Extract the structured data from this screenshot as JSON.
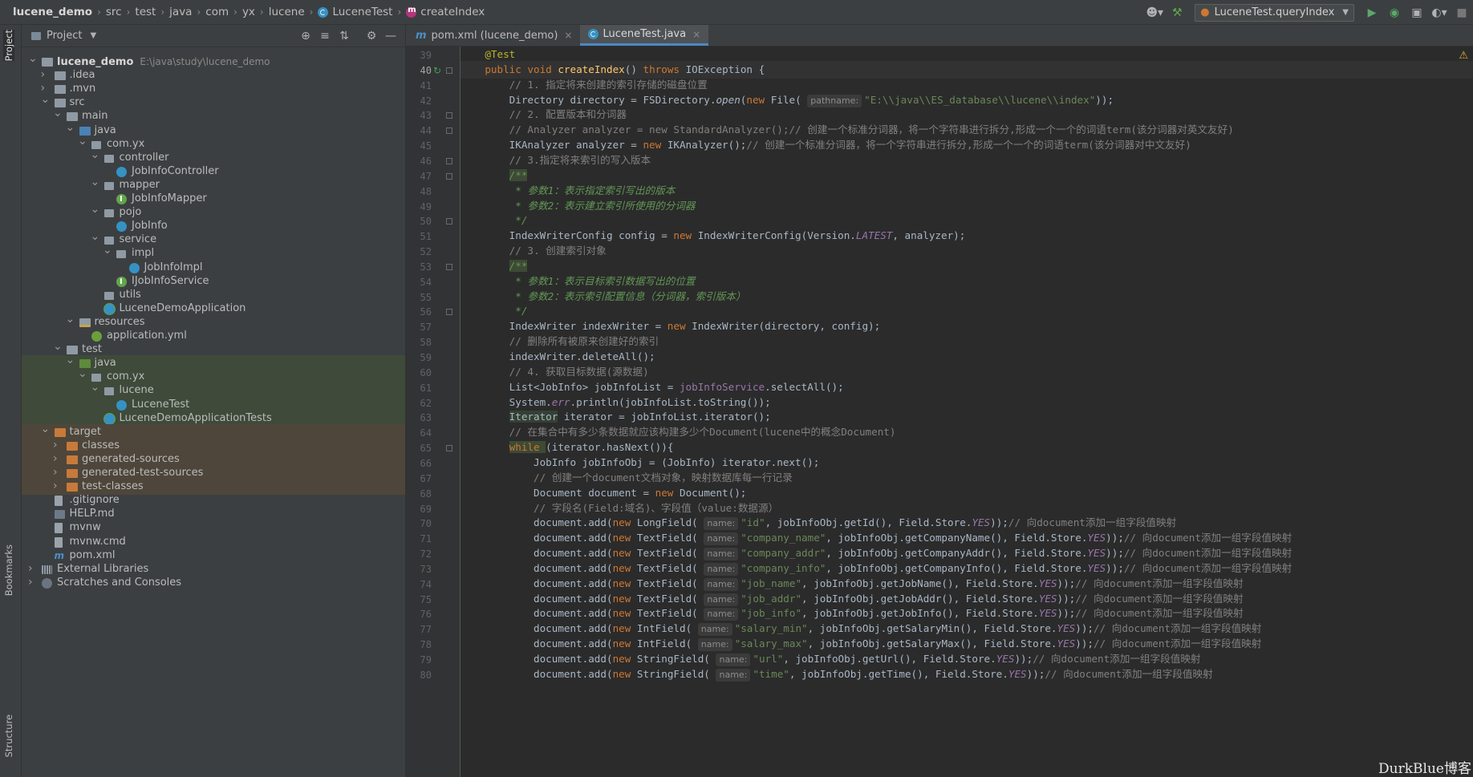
{
  "breadcrumbs": [
    "lucene_demo",
    "src",
    "test",
    "java",
    "com",
    "yx",
    "lucene",
    "LuceneTest",
    "createIndex"
  ],
  "toolbar": {
    "run_config": "LuceneTest.queryIndex"
  },
  "left_stripe": {
    "project_tab": "Project",
    "bookmarks_tab": "Bookmarks",
    "structure_tab": "Structure"
  },
  "project_panel": {
    "title": "Project",
    "tree": [
      {
        "label": "lucene_demo",
        "path": "E:\\java\\study\\lucene_demo",
        "depth": 0,
        "arrow": "open",
        "icon": "folder-icon",
        "style": "bold"
      },
      {
        "label": ".idea",
        "depth": 1,
        "arrow": "closed",
        "icon": "folder-icon"
      },
      {
        "label": ".mvn",
        "depth": 1,
        "arrow": "closed",
        "icon": "folder-icon"
      },
      {
        "label": "src",
        "depth": 1,
        "arrow": "open",
        "icon": "folder-icon"
      },
      {
        "label": "main",
        "depth": 2,
        "arrow": "open",
        "icon": "folder-icon"
      },
      {
        "label": "java",
        "depth": 3,
        "arrow": "open",
        "icon": "source-folder-icon"
      },
      {
        "label": "com.yx",
        "depth": 4,
        "arrow": "open",
        "icon": "package-icon"
      },
      {
        "label": "controller",
        "depth": 5,
        "arrow": "open",
        "icon": "package-icon"
      },
      {
        "label": "JobInfoController",
        "depth": 6,
        "arrow": "",
        "icon": "class-icon"
      },
      {
        "label": "mapper",
        "depth": 5,
        "arrow": "open",
        "icon": "package-icon"
      },
      {
        "label": "JobInfoMapper",
        "depth": 6,
        "arrow": "",
        "icon": "interface-icon"
      },
      {
        "label": "pojo",
        "depth": 5,
        "arrow": "open",
        "icon": "package-icon"
      },
      {
        "label": "JobInfo",
        "depth": 6,
        "arrow": "",
        "icon": "class-icon"
      },
      {
        "label": "service",
        "depth": 5,
        "arrow": "open",
        "icon": "package-icon"
      },
      {
        "label": "impl",
        "depth": 6,
        "arrow": "open",
        "icon": "package-icon"
      },
      {
        "label": "JobInfoImpl",
        "depth": 7,
        "arrow": "",
        "icon": "class-icon"
      },
      {
        "label": "IJobInfoService",
        "depth": 6,
        "arrow": "",
        "icon": "interface-icon"
      },
      {
        "label": "utils",
        "depth": 5,
        "arrow": "",
        "icon": "package-icon"
      },
      {
        "label": "LuceneDemoApplication",
        "depth": 5,
        "arrow": "",
        "icon": "spring-class-icon"
      },
      {
        "label": "resources",
        "depth": 3,
        "arrow": "open",
        "icon": "resources-folder-icon"
      },
      {
        "label": "application.yml",
        "depth": 4,
        "arrow": "",
        "icon": "yml-file-icon"
      },
      {
        "label": "test",
        "depth": 2,
        "arrow": "open",
        "icon": "folder-icon"
      },
      {
        "label": "java",
        "depth": 3,
        "arrow": "open",
        "icon": "test-folder-icon",
        "bg": "green"
      },
      {
        "label": "com.yx",
        "depth": 4,
        "arrow": "open",
        "icon": "package-icon",
        "bg": "green"
      },
      {
        "label": "lucene",
        "depth": 5,
        "arrow": "open",
        "icon": "package-icon",
        "bg": "green"
      },
      {
        "label": "LuceneTest",
        "depth": 6,
        "arrow": "",
        "icon": "class-icon",
        "bg": "green"
      },
      {
        "label": "LuceneDemoApplicationTests",
        "depth": 5,
        "arrow": "",
        "icon": "spring-class-icon",
        "bg": "green"
      },
      {
        "label": "target",
        "depth": 1,
        "arrow": "open",
        "icon": "target-folder-icon",
        "bg": "brown"
      },
      {
        "label": "classes",
        "depth": 2,
        "arrow": "closed",
        "icon": "target-folder-icon",
        "bg": "brown"
      },
      {
        "label": "generated-sources",
        "depth": 2,
        "arrow": "closed",
        "icon": "target-folder-icon",
        "bg": "brown"
      },
      {
        "label": "generated-test-sources",
        "depth": 2,
        "arrow": "closed",
        "icon": "target-folder-icon",
        "bg": "brown"
      },
      {
        "label": "test-classes",
        "depth": 2,
        "arrow": "closed",
        "icon": "target-folder-icon",
        "bg": "brown"
      },
      {
        "label": ".gitignore",
        "depth": 1,
        "arrow": "",
        "icon": "file-icon"
      },
      {
        "label": "HELP.md",
        "depth": 1,
        "arrow": "",
        "icon": "markdown-file-icon"
      },
      {
        "label": "mvnw",
        "depth": 1,
        "arrow": "",
        "icon": "file-icon"
      },
      {
        "label": "mvnw.cmd",
        "depth": 1,
        "arrow": "",
        "icon": "file-icon"
      },
      {
        "label": "pom.xml",
        "depth": 1,
        "arrow": "",
        "icon": "maven-file-icon"
      },
      {
        "label": "External Libraries",
        "depth": 0,
        "arrow": "closed",
        "icon": "library-icon"
      },
      {
        "label": "Scratches and Consoles",
        "depth": 0,
        "arrow": "closed",
        "icon": "scratch-icon"
      }
    ]
  },
  "editor": {
    "tabs": [
      {
        "label": "pom.xml (lucene_demo)",
        "icon": "maven-file-icon",
        "active": false
      },
      {
        "label": "LuceneTest.java",
        "icon": "class-icon",
        "active": true
      }
    ],
    "first_line": 39,
    "current_line": 40,
    "lines": [
      [
        [
          "    ",
          ""
        ],
        [
          "@Test",
          "ann"
        ]
      ],
      [
        [
          "    ",
          ""
        ],
        [
          "public void ",
          "kw"
        ],
        [
          "createIndex",
          "fn"
        ],
        [
          "() ",
          ""
        ],
        [
          "throws ",
          "kw"
        ],
        [
          "IOException {",
          ""
        ]
      ],
      [
        [
          "        ",
          ""
        ],
        [
          "// 1. 指定将来创建的索引存储的磁盘位置",
          "cmt"
        ]
      ],
      [
        [
          "        Directory directory = FSDirectory.",
          ""
        ],
        [
          "open",
          "mthi"
        ],
        [
          "(",
          ""
        ],
        [
          "new ",
          "kw"
        ],
        [
          "File( ",
          ""
        ],
        [
          "pathname:",
          "hint"
        ],
        [
          "\"E:\\\\java\\\\ES_database\\\\lucene\\\\index\"",
          "str"
        ],
        [
          "));",
          ""
        ]
      ],
      [
        [
          "        ",
          ""
        ],
        [
          "// 2. 配置版本和分词器",
          "cmt"
        ]
      ],
      [
        [
          "        ",
          ""
        ],
        [
          "// Analyzer analyzer = new StandardAnalyzer();// 创建一个标准分词器，将一个字符串进行拆分,形成一个一个的词语term(该分词器对英文友好)",
          "cmt"
        ]
      ],
      [
        [
          "        IKAnalyzer analyzer = ",
          ""
        ],
        [
          "new ",
          "kw"
        ],
        [
          "IKAnalyzer();",
          ""
        ],
        [
          "// 创建一个标准分词器，将一个字符串进行拆分,形成一个一个的词语term(该分词器对中文友好)",
          "cmt"
        ]
      ],
      [
        [
          "        ",
          ""
        ],
        [
          "// 3.指定将来索引的写入版本",
          "cmt"
        ]
      ],
      [
        [
          "        ",
          ""
        ],
        [
          "/**",
          "doc docbg"
        ]
      ],
      [
        [
          "        ",
          ""
        ],
        [
          " * 参数1：表示指定索引写出的版本",
          "doc"
        ]
      ],
      [
        [
          "        ",
          ""
        ],
        [
          " * 参数2：表示建立索引所使用的分词器",
          "doc"
        ]
      ],
      [
        [
          "        ",
          ""
        ],
        [
          " */",
          "doc"
        ]
      ],
      [
        [
          "        IndexWriterConfig config = ",
          ""
        ],
        [
          "new ",
          "kw"
        ],
        [
          "IndexWriterConfig(Version.",
          ""
        ],
        [
          "LATEST",
          "fldi"
        ],
        [
          ", analyzer);",
          ""
        ]
      ],
      [
        [
          "        ",
          ""
        ],
        [
          "// 3. 创建索引对象",
          "cmt"
        ]
      ],
      [
        [
          "        ",
          ""
        ],
        [
          "/**",
          "doc docbg"
        ]
      ],
      [
        [
          "        ",
          ""
        ],
        [
          " * 参数1：表示目标索引数据写出的位置",
          "doc"
        ]
      ],
      [
        [
          "        ",
          ""
        ],
        [
          " * 参数2：表示索引配置信息（分词器，索引版本）",
          "doc"
        ]
      ],
      [
        [
          "        ",
          ""
        ],
        [
          " */",
          "doc"
        ]
      ],
      [
        [
          "        IndexWriter indexWriter = ",
          ""
        ],
        [
          "new ",
          "kw"
        ],
        [
          "IndexWriter(directory, config);",
          ""
        ]
      ],
      [
        [
          "        ",
          ""
        ],
        [
          "// 删除所有被原来创建好的索引",
          "cmt"
        ]
      ],
      [
        [
          "        indexWriter.deleteAll();",
          ""
        ]
      ],
      [
        [
          "        ",
          ""
        ],
        [
          "// 4. 获取目标数据(源数据)",
          "cmt"
        ]
      ],
      [
        [
          "        List<JobInfo> jobInfoList = ",
          ""
        ],
        [
          "jobInfoService",
          "fld"
        ],
        [
          ".selectAll();",
          ""
        ]
      ],
      [
        [
          "        System.",
          ""
        ],
        [
          "err",
          "fldi"
        ],
        [
          ".println(jobInfoList.toString());",
          ""
        ]
      ],
      [
        [
          "        ",
          ""
        ],
        [
          "Iterator",
          "iter-bg"
        ],
        [
          " iterator = jobInfoList.iterator();",
          ""
        ]
      ],
      [
        [
          "        ",
          ""
        ],
        [
          "// 在集合中有多少条数据就应该构建多少个Document(lucene中的概念Document)",
          "cmt"
        ]
      ],
      [
        [
          "        ",
          ""
        ],
        [
          "while ",
          "kw docbg"
        ],
        [
          "(iterator.hasNext()){",
          ""
        ]
      ],
      [
        [
          "            JobInfo jobInfoObj = (JobInfo) iterator.next();",
          ""
        ]
      ],
      [
        [
          "            ",
          ""
        ],
        [
          "// 创建一个document文档对象，映射数据库每一行记录",
          "cmt"
        ]
      ],
      [
        [
          "            Document document = ",
          ""
        ],
        [
          "new ",
          "kw"
        ],
        [
          "Document();",
          ""
        ]
      ],
      [
        [
          "            ",
          ""
        ],
        [
          "// 字段名(Field:域名)、字段值（value:数据源）",
          "cmt"
        ]
      ],
      [
        [
          "            document.add(",
          ""
        ],
        [
          "new ",
          "kw"
        ],
        [
          "LongField( ",
          ""
        ],
        [
          "name:",
          "hint"
        ],
        [
          "\"id\"",
          "str"
        ],
        [
          ", jobInfoObj.getId(), Field.Store.",
          ""
        ],
        [
          "YES",
          "fldi"
        ],
        [
          "));",
          ""
        ],
        [
          "// 向document添加一组字段值映射",
          "cmt"
        ]
      ],
      [
        [
          "            document.add(",
          ""
        ],
        [
          "new ",
          "kw"
        ],
        [
          "TextField( ",
          ""
        ],
        [
          "name:",
          "hint"
        ],
        [
          "\"company_name\"",
          "str"
        ],
        [
          ", jobInfoObj.getCompanyName(), Field.Store.",
          ""
        ],
        [
          "YES",
          "fldi"
        ],
        [
          "));",
          ""
        ],
        [
          "// 向document添加一组字段值映射",
          "cmt"
        ]
      ],
      [
        [
          "            document.add(",
          ""
        ],
        [
          "new ",
          "kw"
        ],
        [
          "TextField( ",
          ""
        ],
        [
          "name:",
          "hint"
        ],
        [
          "\"company_addr\"",
          "str"
        ],
        [
          ", jobInfoObj.getCompanyAddr(), Field.Store.",
          ""
        ],
        [
          "YES",
          "fldi"
        ],
        [
          "));",
          ""
        ],
        [
          "// 向document添加一组字段值映射",
          "cmt"
        ]
      ],
      [
        [
          "            document.add(",
          ""
        ],
        [
          "new ",
          "kw"
        ],
        [
          "TextField( ",
          ""
        ],
        [
          "name:",
          "hint"
        ],
        [
          "\"company_info\"",
          "str"
        ],
        [
          ", jobInfoObj.getCompanyInfo(), Field.Store.",
          ""
        ],
        [
          "YES",
          "fldi"
        ],
        [
          "));",
          ""
        ],
        [
          "// 向document添加一组字段值映射",
          "cmt"
        ]
      ],
      [
        [
          "            document.add(",
          ""
        ],
        [
          "new ",
          "kw"
        ],
        [
          "TextField( ",
          ""
        ],
        [
          "name:",
          "hint"
        ],
        [
          "\"job_name\"",
          "str"
        ],
        [
          ", jobInfoObj.getJobName(), Field.Store.",
          ""
        ],
        [
          "YES",
          "fldi"
        ],
        [
          "));",
          ""
        ],
        [
          "// 向document添加一组字段值映射",
          "cmt"
        ]
      ],
      [
        [
          "            document.add(",
          ""
        ],
        [
          "new ",
          "kw"
        ],
        [
          "TextField( ",
          ""
        ],
        [
          "name:",
          "hint"
        ],
        [
          "\"job_addr\"",
          "str"
        ],
        [
          ", jobInfoObj.getJobAddr(), Field.Store.",
          ""
        ],
        [
          "YES",
          "fldi"
        ],
        [
          "));",
          ""
        ],
        [
          "// 向document添加一组字段值映射",
          "cmt"
        ]
      ],
      [
        [
          "            document.add(",
          ""
        ],
        [
          "new ",
          "kw"
        ],
        [
          "TextField( ",
          ""
        ],
        [
          "name:",
          "hint"
        ],
        [
          "\"job_info\"",
          "str"
        ],
        [
          ", jobInfoObj.getJobInfo(), Field.Store.",
          ""
        ],
        [
          "YES",
          "fldi"
        ],
        [
          "));",
          ""
        ],
        [
          "// 向document添加一组字段值映射",
          "cmt"
        ]
      ],
      [
        [
          "            document.add(",
          ""
        ],
        [
          "new ",
          "kw"
        ],
        [
          "IntField( ",
          ""
        ],
        [
          "name:",
          "hint"
        ],
        [
          "\"salary_min\"",
          "str"
        ],
        [
          ", jobInfoObj.getSalaryMin(), Field.Store.",
          ""
        ],
        [
          "YES",
          "fldi"
        ],
        [
          "));",
          ""
        ],
        [
          "// 向document添加一组字段值映射",
          "cmt"
        ]
      ],
      [
        [
          "            document.add(",
          ""
        ],
        [
          "new ",
          "kw"
        ],
        [
          "IntField( ",
          ""
        ],
        [
          "name:",
          "hint"
        ],
        [
          "\"salary_max\"",
          "str"
        ],
        [
          ", jobInfoObj.getSalaryMax(), Field.Store.",
          ""
        ],
        [
          "YES",
          "fldi"
        ],
        [
          "));",
          ""
        ],
        [
          "// 向document添加一组字段值映射",
          "cmt"
        ]
      ],
      [
        [
          "            document.add(",
          ""
        ],
        [
          "new ",
          "kw"
        ],
        [
          "StringField( ",
          ""
        ],
        [
          "name:",
          "hint"
        ],
        [
          "\"url\"",
          "str"
        ],
        [
          ", jobInfoObj.getUrl(), Field.Store.",
          ""
        ],
        [
          "YES",
          "fldi"
        ],
        [
          "));",
          ""
        ],
        [
          "// 向document添加一组字段值映射",
          "cmt"
        ]
      ],
      [
        [
          "            document.add(",
          ""
        ],
        [
          "new ",
          "kw"
        ],
        [
          "StringField( ",
          ""
        ],
        [
          "name:",
          "hint"
        ],
        [
          "\"time\"",
          "str"
        ],
        [
          ", jobInfoObj.getTime(), Field.Store.",
          ""
        ],
        [
          "YES",
          "fldi"
        ],
        [
          "));",
          ""
        ],
        [
          "// 向document添加一组字段值映射",
          "cmt"
        ]
      ]
    ]
  },
  "watermark": "DurkBlue博客"
}
